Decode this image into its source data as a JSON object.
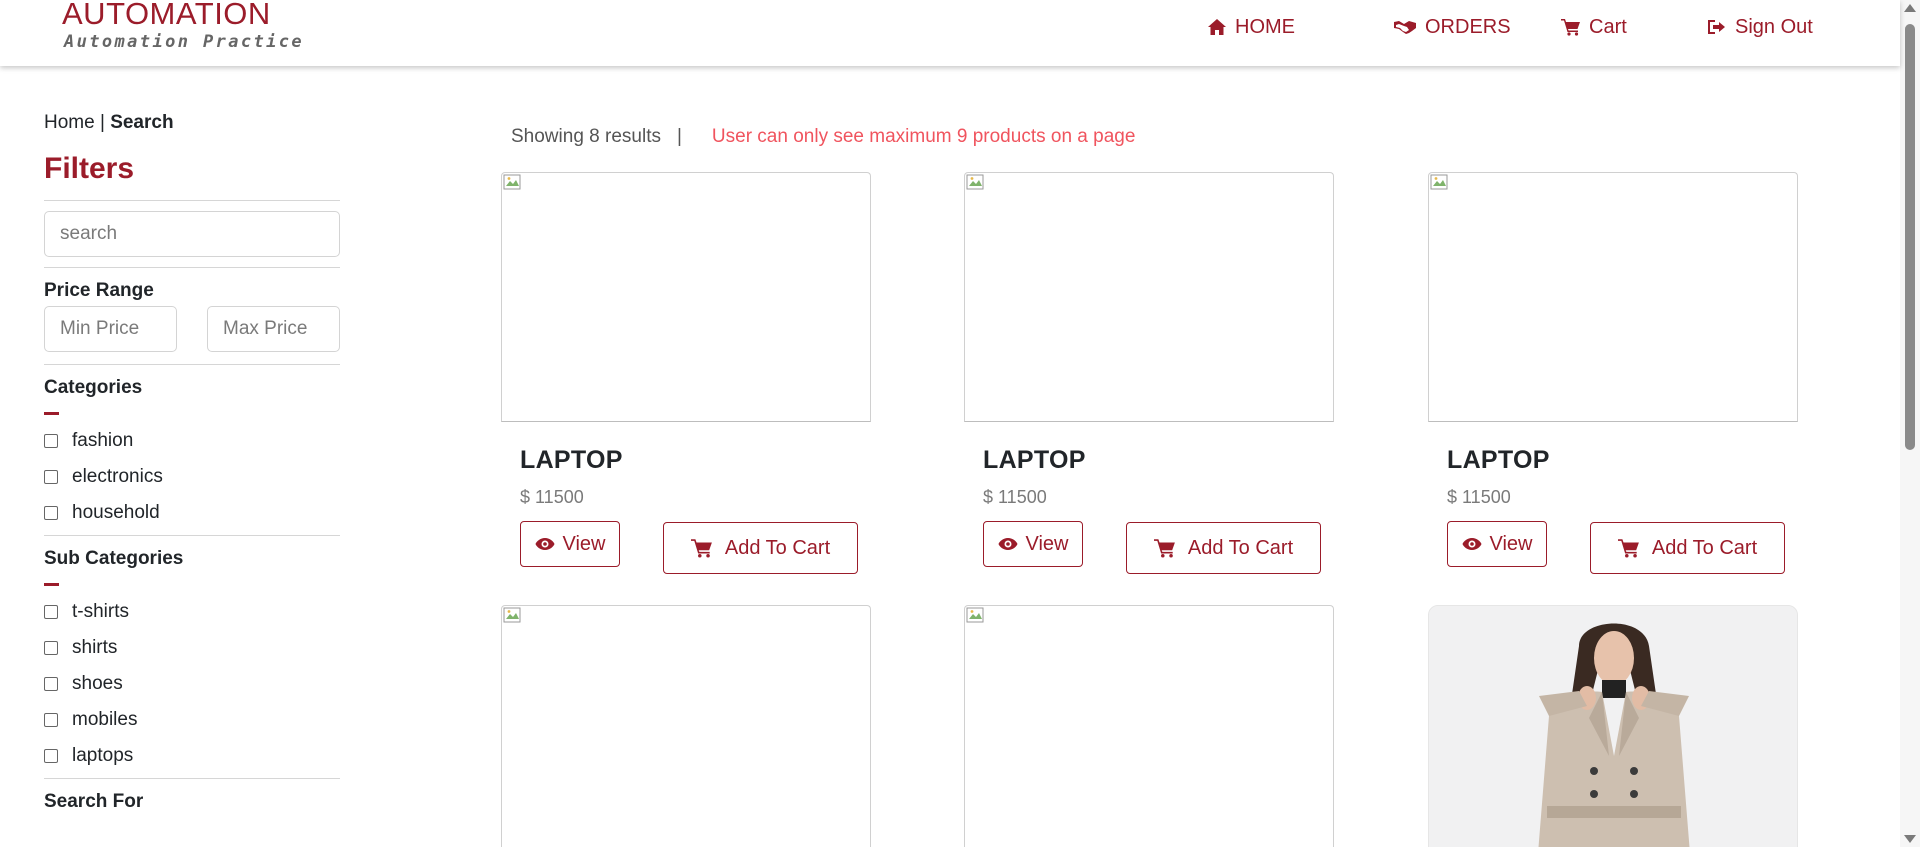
{
  "brand": {
    "title": "AUTOMATION",
    "subtitle": "Automation Practice",
    "accent_color": "#9b1c2a"
  },
  "nav": [
    {
      "label": "HOME",
      "icon": "home-icon"
    },
    {
      "label": "ORDERS",
      "icon": "handshake-icon"
    },
    {
      "label": "Cart",
      "icon": "cart-icon"
    },
    {
      "label": "Sign Out",
      "icon": "sign-out-icon"
    }
  ],
  "breadcrumb": {
    "home": "Home",
    "sep": "|",
    "current": "Search"
  },
  "filters": {
    "title": "Filters",
    "search_placeholder": "search",
    "price_range_label": "Price Range",
    "min_price_placeholder": "Min Price",
    "max_price_placeholder": "Max Price",
    "categories_label": "Categories",
    "categories": [
      "fashion",
      "electronics",
      "household"
    ],
    "subcategories_label": "Sub Categories",
    "subcategories": [
      "t-shirts",
      "shirts",
      "shoes",
      "mobiles",
      "laptops"
    ],
    "search_for_label": "Search For"
  },
  "results": {
    "count_text": "Showing 8 results",
    "separator": "|",
    "note": "User can only see maximum 9 products on a page",
    "note_color": "#f0545e"
  },
  "products": [
    {
      "name": "LAPTOP",
      "price": "$ 11500",
      "view_label": "View",
      "cart_label": "Add To Cart"
    },
    {
      "name": "LAPTOP",
      "price": "$ 11500",
      "view_label": "View",
      "cart_label": "Add To Cart"
    },
    {
      "name": "LAPTOP",
      "price": "$ 11500",
      "view_label": "View",
      "cart_label": "Add To Cart"
    }
  ]
}
